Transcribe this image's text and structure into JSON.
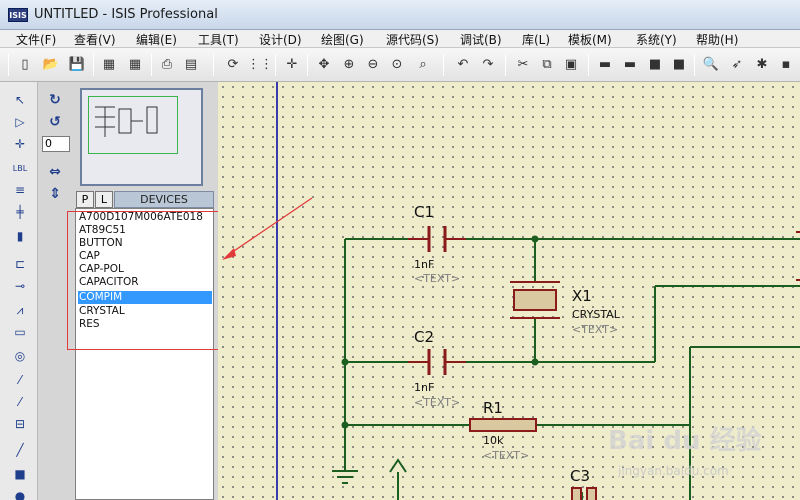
{
  "window": {
    "title": "UNTITLED - ISIS Professional",
    "logo": "ISIS"
  },
  "menu": [
    "文件(F)",
    "查看(V)",
    "编辑(E)",
    "工具(T)",
    "设计(D)",
    "绘图(G)",
    "源代码(S)",
    "调试(B)",
    "库(L)",
    "模板(M)",
    "系统(Y)",
    "帮助(H)"
  ],
  "toolbar_icons": [
    "new-icon",
    "open-icon",
    "save-icon",
    "import-icon",
    "export-icon",
    "print-icon",
    "print-setup-icon",
    "refresh-icon",
    "grid-icon",
    "origin-icon",
    "pan-icon",
    "zoom-in-icon",
    "zoom-out-icon",
    "zoom-all-icon",
    "zoom-area-icon",
    "undo-icon",
    "redo-icon",
    "cut-icon",
    "copy-icon",
    "paste-icon",
    "block-copy-icon",
    "block-move-icon",
    "block-rotate-icon",
    "block-delete-icon",
    "pick-device-icon",
    "make-device-icon",
    "package-icon"
  ],
  "sidepanel": {
    "angle_value": "0",
    "p_label": "P",
    "l_label": "L",
    "devices_header": "DEVICES",
    "devices": [
      "A700D107M006ATE018",
      "AT89C51",
      "BUTTON",
      "CAP",
      "CAP-POL",
      "CAPACITOR",
      "COMPIM",
      "CRYSTAL",
      "RES"
    ],
    "selected_device": "COMPIM"
  },
  "schematic": {
    "c1": {
      "ref": "C1",
      "value": "1nF",
      "text": "<TEXT>"
    },
    "c2": {
      "ref": "C2",
      "value": "1nF",
      "text": "<TEXT>"
    },
    "x1": {
      "ref": "X1",
      "value": "CRYSTAL",
      "text": "<TEXT>"
    },
    "r1": {
      "ref": "R1",
      "value": "10k",
      "text": "<TEXT>"
    },
    "c3": {
      "ref": "C3"
    }
  },
  "watermark": {
    "main": "Bai du 经验",
    "sub": "jingyan.baidu.com"
  },
  "colors": {
    "wire": "#1b5e20",
    "component": "#8b1a1a",
    "annotation": "#e23b3b",
    "sheet_border": "#3b3bb0"
  }
}
